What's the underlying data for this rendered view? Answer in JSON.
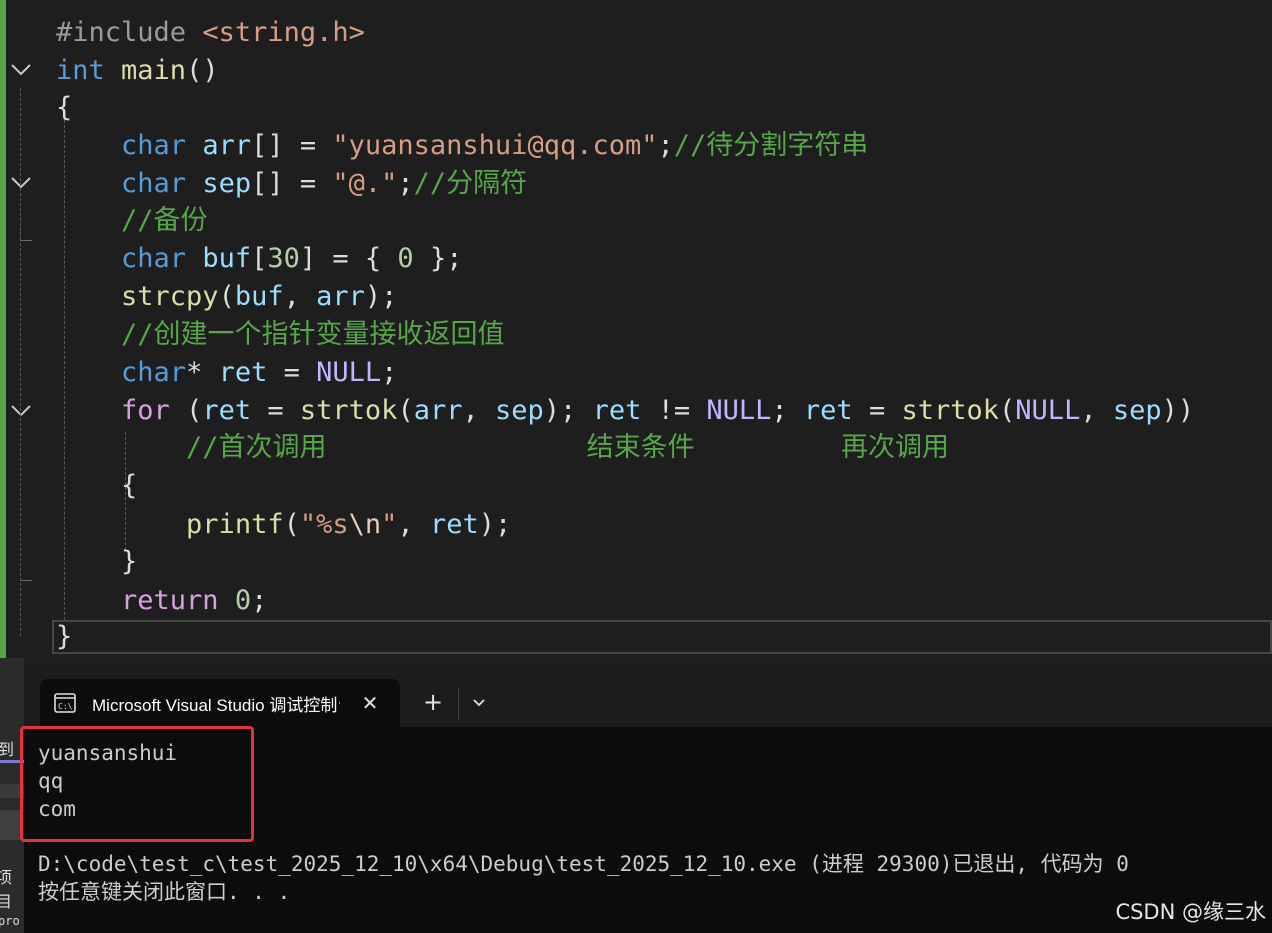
{
  "editor": {
    "lines": [
      [
        {
          "t": "#include ",
          "c": "pre"
        },
        {
          "t": "<string.h>",
          "c": "inc"
        }
      ],
      [
        {
          "t": "int ",
          "c": "kw"
        },
        {
          "t": "main",
          "c": "fn"
        },
        {
          "t": "()",
          "c": "plain"
        }
      ],
      [
        {
          "t": "{",
          "c": "plain"
        }
      ],
      [
        {
          "t": "    ",
          "c": "plain"
        },
        {
          "t": "char ",
          "c": "kw"
        },
        {
          "t": "arr",
          "c": "var"
        },
        {
          "t": "[] = ",
          "c": "plain"
        },
        {
          "t": "\"yuansanshui@qq.com\"",
          "c": "str"
        },
        {
          "t": ";",
          "c": "plain"
        },
        {
          "t": "//待分割字符串",
          "c": "cmt"
        }
      ],
      [
        {
          "t": "    ",
          "c": "plain"
        },
        {
          "t": "char ",
          "c": "kw"
        },
        {
          "t": "sep",
          "c": "var"
        },
        {
          "t": "[] = ",
          "c": "plain"
        },
        {
          "t": "\"@.\"",
          "c": "str"
        },
        {
          "t": ";",
          "c": "plain"
        },
        {
          "t": "//分隔符",
          "c": "cmt"
        }
      ],
      [
        {
          "t": "    ",
          "c": "plain"
        },
        {
          "t": "//备份",
          "c": "cmt"
        }
      ],
      [
        {
          "t": "    ",
          "c": "plain"
        },
        {
          "t": "char ",
          "c": "kw"
        },
        {
          "t": "buf",
          "c": "var"
        },
        {
          "t": "[",
          "c": "plain"
        },
        {
          "t": "30",
          "c": "num"
        },
        {
          "t": "] = { ",
          "c": "plain"
        },
        {
          "t": "0",
          "c": "num"
        },
        {
          "t": " };",
          "c": "plain"
        }
      ],
      [
        {
          "t": "    ",
          "c": "plain"
        },
        {
          "t": "strcpy",
          "c": "fn"
        },
        {
          "t": "(",
          "c": "plain"
        },
        {
          "t": "buf",
          "c": "var"
        },
        {
          "t": ", ",
          "c": "plain"
        },
        {
          "t": "arr",
          "c": "var"
        },
        {
          "t": ");",
          "c": "plain"
        }
      ],
      [
        {
          "t": "    ",
          "c": "plain"
        },
        {
          "t": "//创建一个指针变量接收返回值",
          "c": "cmt"
        }
      ],
      [
        {
          "t": "    ",
          "c": "plain"
        },
        {
          "t": "char",
          "c": "kw"
        },
        {
          "t": "* ",
          "c": "plain"
        },
        {
          "t": "ret",
          "c": "var"
        },
        {
          "t": " = ",
          "c": "plain"
        },
        {
          "t": "NULL",
          "c": "mac"
        },
        {
          "t": ";",
          "c": "plain"
        }
      ],
      [
        {
          "t": "    ",
          "c": "plain"
        },
        {
          "t": "for",
          "c": "kwp"
        },
        {
          "t": " (",
          "c": "plain"
        },
        {
          "t": "ret",
          "c": "var"
        },
        {
          "t": " = ",
          "c": "plain"
        },
        {
          "t": "strtok",
          "c": "fn"
        },
        {
          "t": "(",
          "c": "plain"
        },
        {
          "t": "arr",
          "c": "var"
        },
        {
          "t": ", ",
          "c": "plain"
        },
        {
          "t": "sep",
          "c": "var"
        },
        {
          "t": "); ",
          "c": "plain"
        },
        {
          "t": "ret",
          "c": "var"
        },
        {
          "t": " != ",
          "c": "plain"
        },
        {
          "t": "NULL",
          "c": "mac"
        },
        {
          "t": "; ",
          "c": "plain"
        },
        {
          "t": "ret",
          "c": "var"
        },
        {
          "t": " = ",
          "c": "plain"
        },
        {
          "t": "strtok",
          "c": "fn"
        },
        {
          "t": "(",
          "c": "plain"
        },
        {
          "t": "NULL",
          "c": "mac"
        },
        {
          "t": ", ",
          "c": "plain"
        },
        {
          "t": "sep",
          "c": "var"
        },
        {
          "t": "))",
          "c": "plain"
        }
      ],
      [
        {
          "t": "        ",
          "c": "plain"
        },
        {
          "t": "//首次调用                结束条件         再次调用",
          "c": "cmt"
        }
      ],
      [
        {
          "t": "    {",
          "c": "plain"
        }
      ],
      [
        {
          "t": "        ",
          "c": "plain"
        },
        {
          "t": "printf",
          "c": "fn"
        },
        {
          "t": "(",
          "c": "plain"
        },
        {
          "t": "\"%s",
          "c": "str"
        },
        {
          "t": "\\n",
          "c": "esc"
        },
        {
          "t": "\"",
          "c": "str"
        },
        {
          "t": ", ",
          "c": "plain"
        },
        {
          "t": "ret",
          "c": "var"
        },
        {
          "t": ");",
          "c": "plain"
        }
      ],
      [
        {
          "t": "    }",
          "c": "plain"
        }
      ],
      [
        {
          "t": "    ",
          "c": "plain"
        },
        {
          "t": "return",
          "c": "kwp"
        },
        {
          "t": " ",
          "c": "plain"
        },
        {
          "t": "0",
          "c": "num"
        },
        {
          "t": ";",
          "c": "plain"
        }
      ],
      [
        {
          "t": "}",
          "c": "plain"
        }
      ]
    ]
  },
  "terminal": {
    "tab_title": "Microsoft Visual Studio 调试控制台",
    "close_glyph": "✕",
    "new_tab_glyph": "+",
    "output": [
      "yuansanshui",
      "qq",
      "com"
    ],
    "exit_message": "D:\\code\\test_c\\test_2025_12_10\\x64\\Debug\\test_2025_12_10.exe (进程 29300)已退出, 代码为 0",
    "press_key": "按任意键关闭此窗口. . ."
  },
  "side_panel": {
    "label_top": "到",
    "label_bottom": "项目",
    "label_code": "pro"
  },
  "watermark": "CSDN @缘三水",
  "colors": {
    "keyword": "#569cd6",
    "control_keyword": "#d8a0df",
    "function": "#dcdcaa",
    "variable": "#9cdcfe",
    "string": "#d69d85",
    "comment": "#57a64a",
    "number": "#b5cea8",
    "macro": "#beb7ff",
    "highlight_box": "#e0343c"
  }
}
